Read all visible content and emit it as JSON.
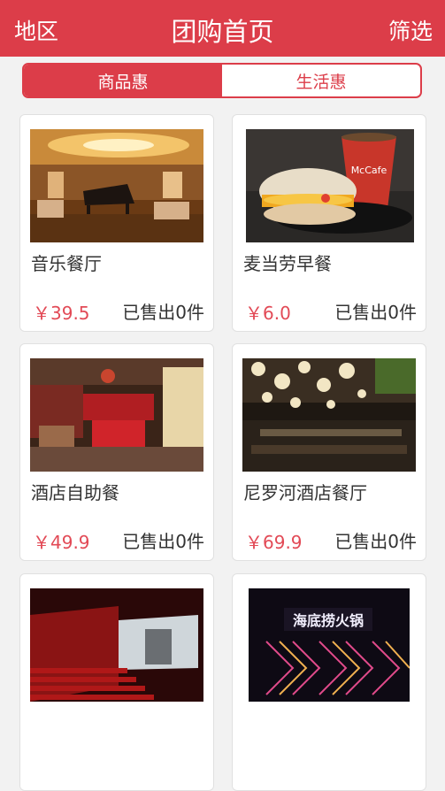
{
  "header": {
    "left": "地区",
    "title": "团购首页",
    "right": "筛选"
  },
  "tabs": [
    {
      "label": "商品惠",
      "active": true
    },
    {
      "label": "生活惠",
      "active": false
    }
  ],
  "items": [
    {
      "name": "音乐餐厅",
      "price": "￥39.5",
      "sold": "已售出0件",
      "image": "music-restaurant"
    },
    {
      "name": "麦当劳早餐",
      "price": "￥6.0",
      "sold": "已售出0件",
      "image": "mcdonalds-breakfast"
    },
    {
      "name": "酒店自助餐",
      "price": "￥49.9",
      "sold": "已售出0件",
      "image": "hotel-buffet"
    },
    {
      "name": "尼罗河酒店餐厅",
      "price": "￥69.9",
      "sold": "已售出0件",
      "image": "nile-hotel-restaurant"
    },
    {
      "name": "",
      "price": "",
      "sold": "",
      "image": "cinema"
    },
    {
      "name": "",
      "price": "",
      "sold": "",
      "image": "haidilao-hotpot",
      "sign_text": "海底捞火锅"
    }
  ],
  "colors": {
    "brand": "#dc3d49",
    "price": "#e24a56"
  }
}
